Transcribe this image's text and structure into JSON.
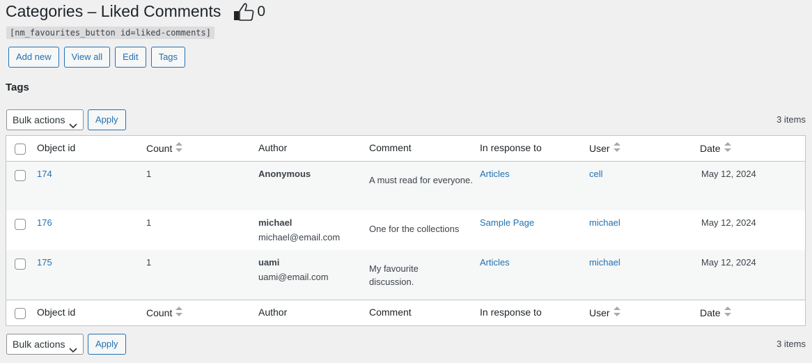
{
  "header": {
    "title": "Categories – Liked Comments",
    "like_count": "0",
    "shortcode": "[nm_favourites_button id=liked-comments]"
  },
  "actions": {
    "add_new": "Add new",
    "view_all": "View all",
    "edit": "Edit",
    "tags": "Tags"
  },
  "section_title": "Tags",
  "tablenav": {
    "bulk_actions": "Bulk actions",
    "apply": "Apply",
    "items": "3 items"
  },
  "columns": {
    "object_id": "Object id",
    "count": "Count",
    "author": "Author",
    "comment": "Comment",
    "in_response_to": "In response to",
    "user": "User",
    "date": "Date"
  },
  "rows": [
    {
      "object_id": "174",
      "count": "1",
      "author_name": "Anonymous",
      "author_email": "",
      "comment": "A must read for everyone.",
      "in_response_to": "Articles",
      "user": "cell",
      "date": "May 12, 2024"
    },
    {
      "object_id": "176",
      "count": "1",
      "author_name": "michael",
      "author_email": "michael@email.com",
      "comment": "One for the collections",
      "in_response_to": "Sample Page",
      "user": "michael",
      "date": "May 12, 2024"
    },
    {
      "object_id": "175",
      "count": "1",
      "author_name": "uami",
      "author_email": "uami@email.com",
      "comment": "My favourite discussion.",
      "in_response_to": "Articles",
      "user": "michael",
      "date": "May 12, 2024"
    }
  ],
  "colors": {
    "link": "#2271b1",
    "background": "#f0f0f1",
    "border": "#c3c4c7"
  },
  "icons": [
    "thumbs-up-icon",
    "chevron-down-icon",
    "sort-icon"
  ]
}
